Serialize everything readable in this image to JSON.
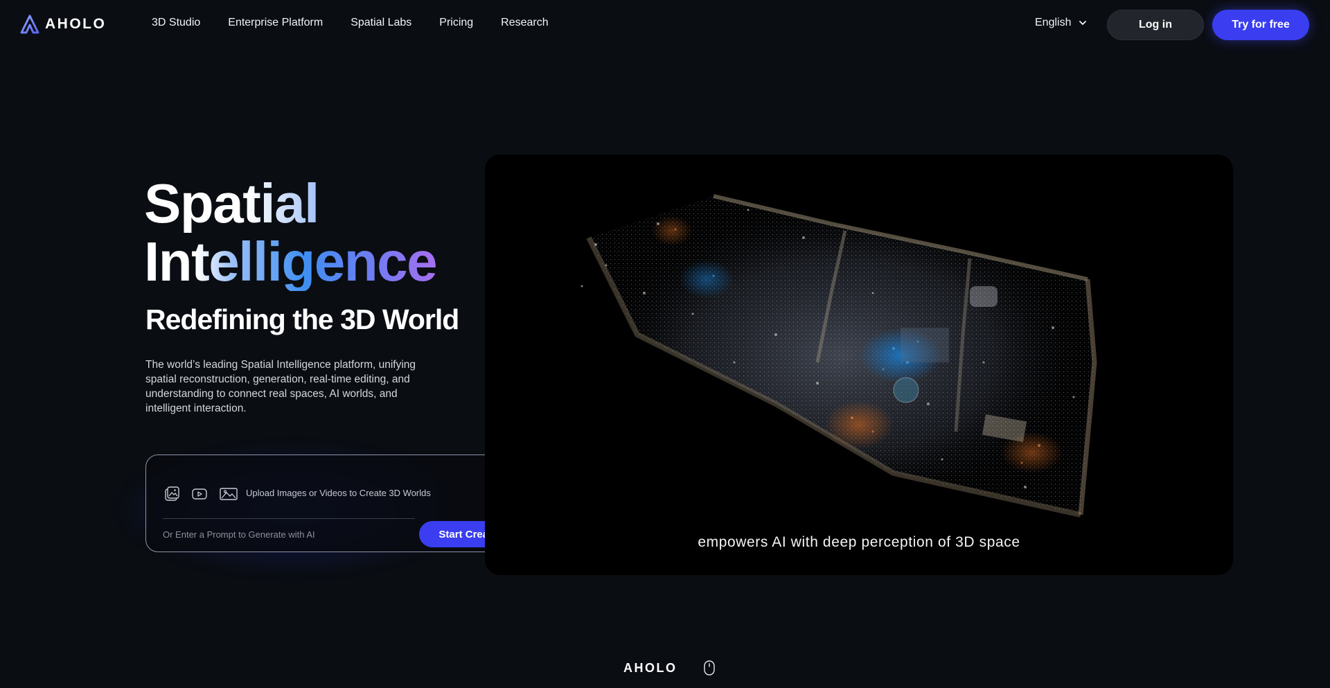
{
  "header": {
    "logo_text": "AHOLO",
    "nav": [
      "3D Studio",
      "Enterprise Platform",
      "Spatial Labs",
      "Pricing",
      "Research"
    ],
    "language": "English",
    "login_label": "Log in",
    "try_label": "Try for free"
  },
  "hero": {
    "headline_line1": "Spatial",
    "headline_line2": "Intelligence",
    "subheadline": "Redefining the 3D World",
    "description": "The world’s leading Spatial Intelligence platform, unifying spatial reconstruction, generation, real-time editing, and understanding to connect real spaces, AI worlds, and intelligent interaction."
  },
  "upload_card": {
    "upload_label": "Upload Images or Videos to Create 3D Worlds",
    "prompt_placeholder": "Or Enter a Prompt to Generate with AI",
    "start_label": "Start Creating",
    "icons": [
      "image-upload-icon",
      "video-icon",
      "picture-icon"
    ]
  },
  "media": {
    "caption": "empowers AI with deep perception of 3D space"
  },
  "footer": {
    "logo_text": "AHOLO",
    "scroll_icon": "mouse-scroll-icon"
  },
  "colors": {
    "background": "#0a0d12",
    "accent": "#3a3ef0",
    "gradient_blue": "#3f8ff2",
    "gradient_purple": "#a66ff0"
  }
}
